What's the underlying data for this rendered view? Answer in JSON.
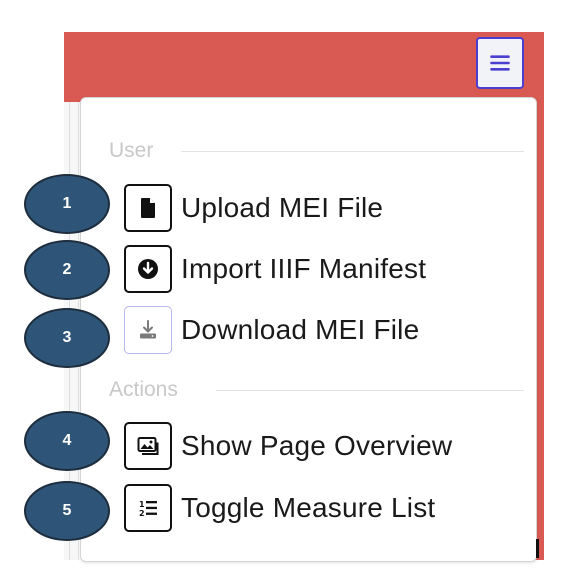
{
  "colors": {
    "navbar": "#d95a52",
    "accent": "#4a3fcf",
    "badge": "#2e5577",
    "header_text": "#c8c8c8",
    "disabled_border": "#b8b8ea"
  },
  "menu": {
    "sections": [
      {
        "header": "User",
        "items": [
          {
            "label": "Upload MEI File",
            "icon": "file-icon",
            "enabled": true
          },
          {
            "label": "Import IIIF Manifest",
            "icon": "arrow-circle-down-icon",
            "enabled": true
          },
          {
            "label": "Download MEI File",
            "icon": "download-icon",
            "enabled": false
          }
        ]
      },
      {
        "header": "Actions",
        "items": [
          {
            "label": "Show Page Overview",
            "icon": "image-icon",
            "enabled": true
          },
          {
            "label": "Toggle Measure List",
            "icon": "numbered-list-icon",
            "enabled": true
          }
        ]
      }
    ]
  },
  "badges": [
    "1",
    "2",
    "3",
    "4",
    "5"
  ]
}
